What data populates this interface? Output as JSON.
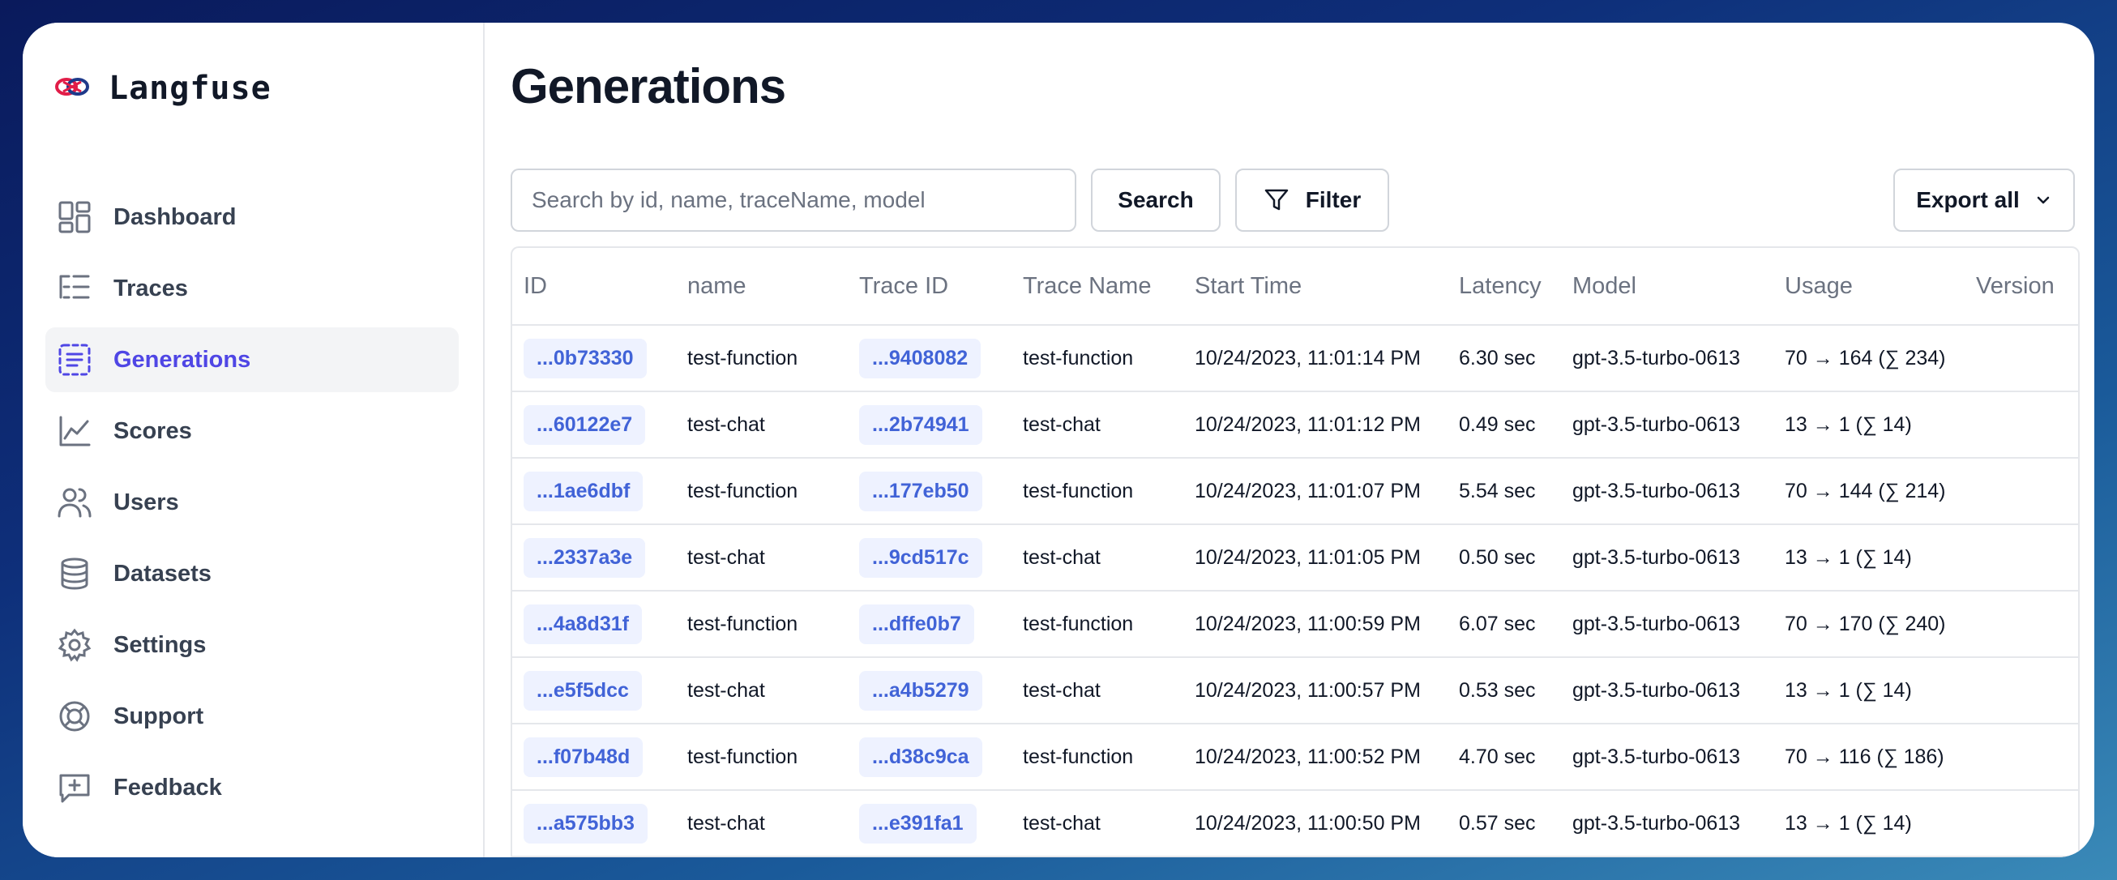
{
  "app": {
    "name": "Langfuse"
  },
  "sidebar": {
    "items": [
      {
        "label": "Dashboard",
        "icon": "dashboard-icon",
        "active": false
      },
      {
        "label": "Traces",
        "icon": "traces-icon",
        "active": false
      },
      {
        "label": "Generations",
        "icon": "generations-icon",
        "active": true
      },
      {
        "label": "Scores",
        "icon": "scores-icon",
        "active": false
      },
      {
        "label": "Users",
        "icon": "users-icon",
        "active": false
      },
      {
        "label": "Datasets",
        "icon": "datasets-icon",
        "active": false
      },
      {
        "label": "Settings",
        "icon": "settings-icon",
        "active": false
      },
      {
        "label": "Support",
        "icon": "support-icon",
        "active": false
      },
      {
        "label": "Feedback",
        "icon": "feedback-icon",
        "active": false
      }
    ]
  },
  "page": {
    "title": "Generations"
  },
  "toolbar": {
    "search_placeholder": "Search by id, name, traceName, model",
    "search_value": "",
    "search_label": "Search",
    "filter_label": "Filter",
    "export_label": "Export all"
  },
  "table": {
    "columns": [
      "ID",
      "name",
      "Trace ID",
      "Trace Name",
      "Start Time",
      "Latency",
      "Model",
      "Usage",
      "Version"
    ],
    "rows": [
      {
        "id": "...0b73330",
        "name": "test-function",
        "trace_id": "...9408082",
        "trace_name": "test-function",
        "start_time": "10/24/2023, 11:01:14 PM",
        "latency": "6.30 sec",
        "model": "gpt-3.5-turbo-0613",
        "usage": "70 → 164 (∑ 234)",
        "version": ""
      },
      {
        "id": "...60122e7",
        "name": "test-chat",
        "trace_id": "...2b74941",
        "trace_name": "test-chat",
        "start_time": "10/24/2023, 11:01:12 PM",
        "latency": "0.49 sec",
        "model": "gpt-3.5-turbo-0613",
        "usage": "13 → 1 (∑ 14)",
        "version": ""
      },
      {
        "id": "...1ae6dbf",
        "name": "test-function",
        "trace_id": "...177eb50",
        "trace_name": "test-function",
        "start_time": "10/24/2023, 11:01:07 PM",
        "latency": "5.54 sec",
        "model": "gpt-3.5-turbo-0613",
        "usage": "70 → 144 (∑ 214)",
        "version": ""
      },
      {
        "id": "...2337a3e",
        "name": "test-chat",
        "trace_id": "...9cd517c",
        "trace_name": "test-chat",
        "start_time": "10/24/2023, 11:01:05 PM",
        "latency": "0.50 sec",
        "model": "gpt-3.5-turbo-0613",
        "usage": "13 → 1 (∑ 14)",
        "version": ""
      },
      {
        "id": "...4a8d31f",
        "name": "test-function",
        "trace_id": "...dffe0b7",
        "trace_name": "test-function",
        "start_time": "10/24/2023, 11:00:59 PM",
        "latency": "6.07 sec",
        "model": "gpt-3.5-turbo-0613",
        "usage": "70 → 170 (∑ 240)",
        "version": ""
      },
      {
        "id": "...e5f5dcc",
        "name": "test-chat",
        "trace_id": "...a4b5279",
        "trace_name": "test-chat",
        "start_time": "10/24/2023, 11:00:57 PM",
        "latency": "0.53 sec",
        "model": "gpt-3.5-turbo-0613",
        "usage": "13 → 1 (∑ 14)",
        "version": ""
      },
      {
        "id": "...f07b48d",
        "name": "test-function",
        "trace_id": "...d38c9ca",
        "trace_name": "test-function",
        "start_time": "10/24/2023, 11:00:52 PM",
        "latency": "4.70 sec",
        "model": "gpt-3.5-turbo-0613",
        "usage": "70 → 116 (∑ 186)",
        "version": ""
      },
      {
        "id": "...a575bb3",
        "name": "test-chat",
        "trace_id": "...e391fa1",
        "trace_name": "test-chat",
        "start_time": "10/24/2023, 11:00:50 PM",
        "latency": "0.57 sec",
        "model": "gpt-3.5-turbo-0613",
        "usage": "13 → 1 (∑ 14)",
        "version": ""
      }
    ]
  },
  "colors": {
    "accent": "#4f46e5",
    "pill_bg": "#eef2ff",
    "pill_text": "#4163d7",
    "border": "#e5e7eb"
  }
}
